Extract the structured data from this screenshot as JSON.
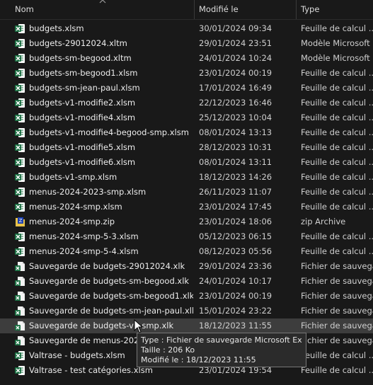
{
  "header": {
    "name": "Nom",
    "modified": "Modifié le",
    "type": "Type"
  },
  "colors": {
    "background": "#191919",
    "excel_green": "#1e7145",
    "zip_yellow": "#e7c24a",
    "selected_row": "#3d3d3d"
  },
  "files": [
    {
      "name": "budgets.xlsm",
      "date": "30/01/2024 09:34",
      "type": "Feuille de calcul ...",
      "icon": "excel-icon"
    },
    {
      "name": "budgets-29012024.xltm",
      "date": "29/01/2024 23:51",
      "type": "Modèle Microsoft ...",
      "icon": "excel-icon"
    },
    {
      "name": "budgets-sm-begood.xltm",
      "date": "24/01/2024 10:24",
      "type": "Modèle Microsoft ...",
      "icon": "excel-icon"
    },
    {
      "name": "budgets-sm-begood1.xlsm",
      "date": "23/01/2024 00:19",
      "type": "Feuille de calcul ...",
      "icon": "excel-icon"
    },
    {
      "name": "budgets-sm-jean-paul.xlsm",
      "date": "17/01/2024 16:49",
      "type": "Feuille de calcul ...",
      "icon": "excel-icon"
    },
    {
      "name": "budgets-v1-modifie2.xlsm",
      "date": "22/12/2023 16:46",
      "type": "Feuille de calcul ...",
      "icon": "excel-icon"
    },
    {
      "name": "budgets-v1-modifie4.xlsm",
      "date": "25/12/2023 10:04",
      "type": "Feuille de calcul ...",
      "icon": "excel-icon"
    },
    {
      "name": "budgets-v1-modifie4-begood-smp.xlsm",
      "date": "08/01/2024 13:13",
      "type": "Feuille de calcul ...",
      "icon": "excel-icon"
    },
    {
      "name": "budgets-v1-modifie5.xlsm",
      "date": "28/12/2023 10:31",
      "type": "Feuille de calcul ...",
      "icon": "excel-icon"
    },
    {
      "name": "budgets-v1-modifie6.xlsm",
      "date": "08/01/2024 13:11",
      "type": "Feuille de calcul ...",
      "icon": "excel-icon"
    },
    {
      "name": "budgets-v1-smp.xlsm",
      "date": "18/12/2023 14:26",
      "type": "Feuille de calcul ...",
      "icon": "excel-icon"
    },
    {
      "name": "menus-2024-2023-smp.xlsm",
      "date": "26/11/2023 11:07",
      "type": "Feuille de calcul ...",
      "icon": "excel-icon"
    },
    {
      "name": "menus-2024-smp.xlsm",
      "date": "23/01/2024 17:45",
      "type": "Feuille de calcul ...",
      "icon": "excel-icon"
    },
    {
      "name": "menus-2024-smp.zip",
      "date": "23/01/2024 18:06",
      "type": "zip Archive",
      "icon": "zip-archive-icon"
    },
    {
      "name": "menus-2024-smp-5-3.xlsm",
      "date": "05/12/2023 06:15",
      "type": "Feuille de calcul ...",
      "icon": "excel-icon"
    },
    {
      "name": "menus-2024-smp-5-4.xlsm",
      "date": "08/12/2023 05:56",
      "type": "Feuille de calcul ...",
      "icon": "excel-icon"
    },
    {
      "name": "Sauvegarde de budgets-29012024.xlk",
      "date": "29/01/2024 23:36",
      "type": "Fichier de sauvega...",
      "icon": "excel-backup-icon"
    },
    {
      "name": "Sauvegarde de budgets-sm-begood.xlk",
      "date": "24/01/2024 10:17",
      "type": "Fichier de sauvega...",
      "icon": "excel-backup-icon"
    },
    {
      "name": "Sauvegarde de budgets-sm-begood1.xlk",
      "date": "23/01/2024 00:19",
      "type": "Fichier de sauvega...",
      "icon": "excel-backup-icon"
    },
    {
      "name": "Sauvegarde de budgets-sm-jean-paul.xlk",
      "date": "15/01/2024 23:22",
      "type": "Fichier de sauvega...",
      "icon": "excel-backup-icon"
    },
    {
      "name": "Sauvegarde de budgets-v1-smp.xlk",
      "date": "18/12/2023 11:55",
      "type": "Fichier de sauvega...",
      "icon": "excel-backup-icon",
      "selected": true
    },
    {
      "name": "Sauvegarde de menus-2024-",
      "date": "",
      "type": "Fichier de sauvega...",
      "icon": "excel-backup-icon"
    },
    {
      "name": "Valtrase - budgets.xlsm",
      "date": "",
      "type": "Feuille de calcul ...",
      "icon": "excel-icon"
    },
    {
      "name": "Valtrase - test catégories.xlsm",
      "date": "23/01/2024 19:54",
      "type": "Feuille de calcul ...",
      "icon": "excel-icon"
    }
  ],
  "tooltip": {
    "type_line": "Type : Fichier de sauvegarde Microsoft Excel",
    "size_line": "Taille : 206 Ko",
    "modified_line": "Modifié le : 18/12/2023 11:55"
  }
}
